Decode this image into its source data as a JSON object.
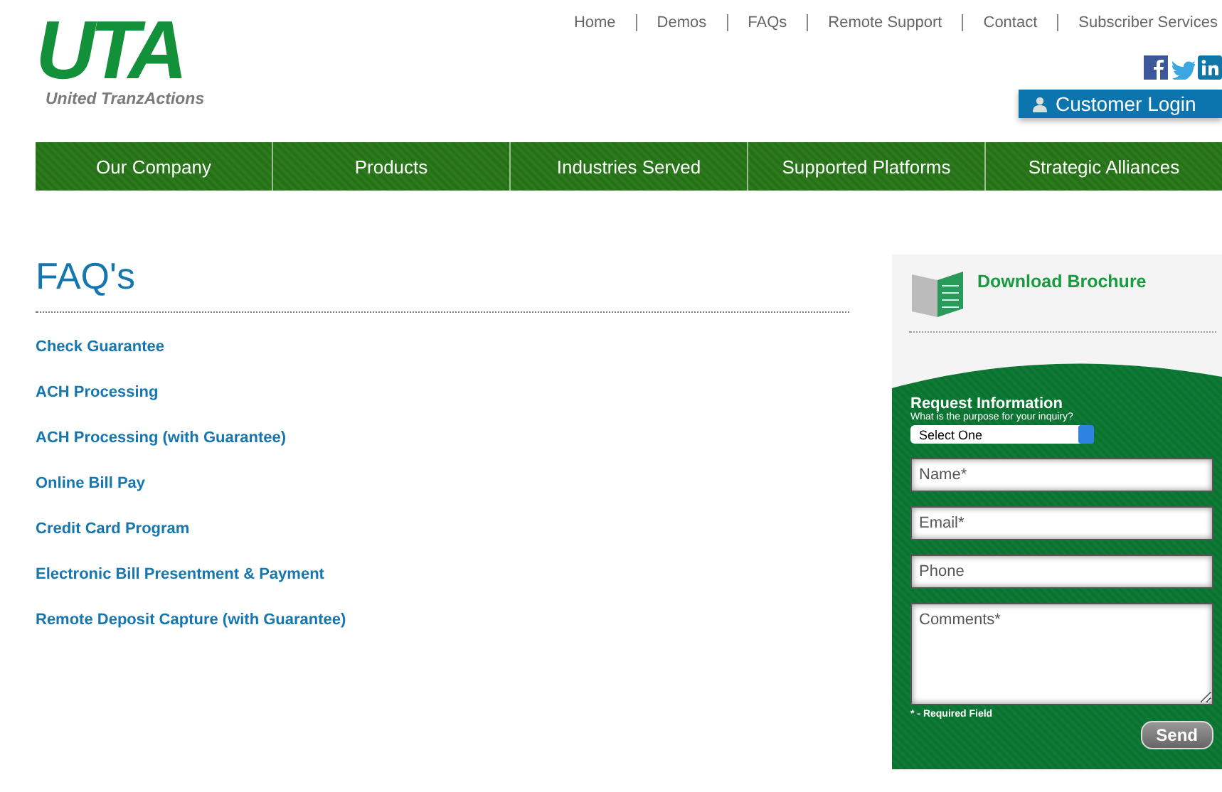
{
  "logo": {
    "mark": "UTA",
    "name": "United TranzActions"
  },
  "top_links": [
    "Home",
    "Demos",
    "FAQs",
    "Remote Support",
    "Contact",
    "Subscriber Services"
  ],
  "login_button": "Customer Login",
  "main_nav": [
    "Our Company",
    "Products",
    "Industries Served",
    "Supported Platforms",
    "Strategic Alliances"
  ],
  "heading": "FAQ's",
  "faq_links": [
    "Check Guarantee",
    "ACH Processing",
    "ACH Processing (with Guarantee)",
    "Online Bill Pay",
    "Credit Card Program",
    "Electronic Bill Presentment & Payment",
    "Remote Deposit Capture (with Guarantee)"
  ],
  "sidebar": {
    "brochure": "Download Brochure",
    "form_title": "Request Information",
    "purpose_label": "What is the purpose for your inquiry?",
    "purpose_value": "Select One",
    "fields": [
      {
        "kind": "input",
        "placeholder": "Name*"
      },
      {
        "kind": "input",
        "placeholder": "Email*"
      },
      {
        "kind": "input",
        "placeholder": "Phone"
      },
      {
        "kind": "textarea",
        "placeholder": "Comments*"
      }
    ],
    "required_note": "* - Required Field",
    "send_button": "Send"
  }
}
